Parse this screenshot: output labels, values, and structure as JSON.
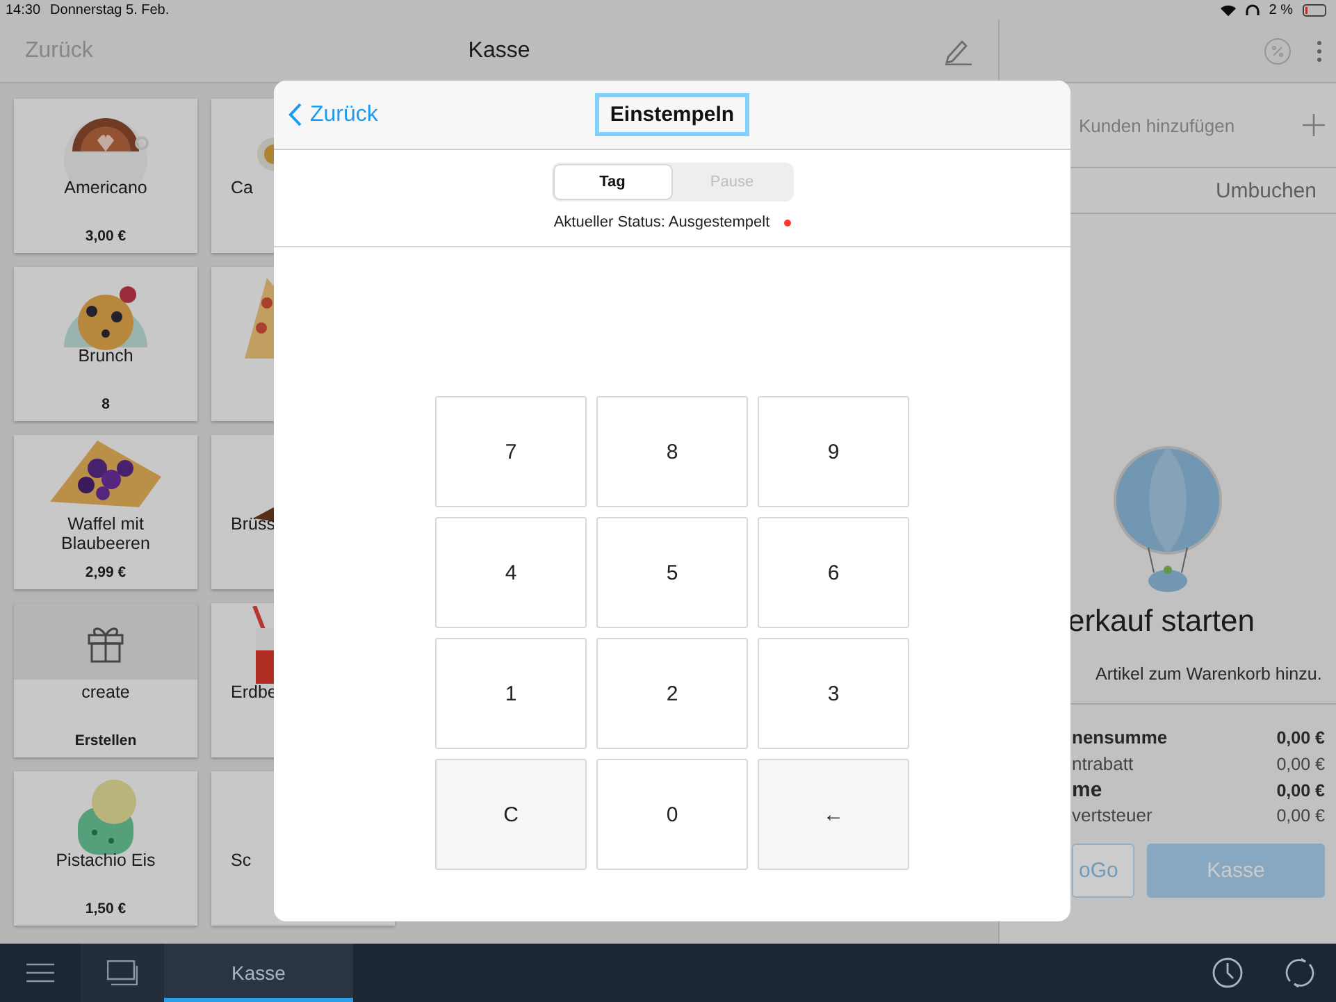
{
  "status_bar": {
    "time": "14:30",
    "date": "Donnerstag 5. Feb.",
    "battery": "2 %"
  },
  "register": {
    "back": "Zurück",
    "title": "Kasse"
  },
  "product_rows": [
    [
      {
        "name": "Americano",
        "price": "3,00 €"
      },
      {
        "name": "Ca"
      }
    ],
    [
      {
        "name": "Brunch",
        "price": "8"
      },
      {}
    ],
    [
      {
        "name": "Waffel mit Blaubeeren",
        "price": "2,99 €"
      },
      {
        "name": "Brüss"
      }
    ],
    [
      {
        "name": "create",
        "price": "Erstellen"
      },
      {
        "name": "Erdbe"
      }
    ],
    [
      {
        "name": "Pistachio Eis",
        "price": "1,50 €"
      },
      {
        "name": "Sc"
      }
    ]
  ],
  "cart": {
    "add_customer": "Kunden hinzufügen",
    "rebook": "Umbuchen",
    "title": "erkauf starten",
    "subtitle": "Artikel zum Warenkorb hinzu.",
    "totals": [
      {
        "label": "nensumme",
        "value": "0,00 €",
        "kind": "subtotal"
      },
      {
        "label": "ntrabatt",
        "value": "0,00 €",
        "kind": "line"
      },
      {
        "label": "me",
        "value": "0,00 €",
        "kind": "total"
      },
      {
        "label": "vertsteuer",
        "value": "0,00 €",
        "kind": "line"
      }
    ],
    "buttons": [
      {
        "label": "oGo",
        "kind": "outline"
      },
      {
        "label": "Kasse",
        "kind": "primary"
      }
    ]
  },
  "dialog": {
    "back": "Zurück",
    "title": "Einstempeln",
    "title_focused": true,
    "segments": [
      {
        "label": "Tag",
        "selected": true
      },
      {
        "label": "Pause",
        "selected": false
      }
    ],
    "status": "Aktueller Status: Ausgestempelt",
    "keys": [
      {
        "label": "7",
        "kind": "digit"
      },
      {
        "label": "8",
        "kind": "digit"
      },
      {
        "label": "9",
        "kind": "digit"
      },
      {
        "label": "4",
        "kind": "digit"
      },
      {
        "label": "5",
        "kind": "digit"
      },
      {
        "label": "6",
        "kind": "digit"
      },
      {
        "label": "1",
        "kind": "digit"
      },
      {
        "label": "2",
        "kind": "digit"
      },
      {
        "label": "3",
        "kind": "digit"
      },
      {
        "label": "C",
        "kind": "action"
      },
      {
        "label": "0",
        "kind": "digit"
      },
      {
        "label": "←",
        "kind": "action"
      }
    ]
  },
  "bottom_tabs": [
    {
      "label": "Kasse",
      "selected": true
    }
  ]
}
